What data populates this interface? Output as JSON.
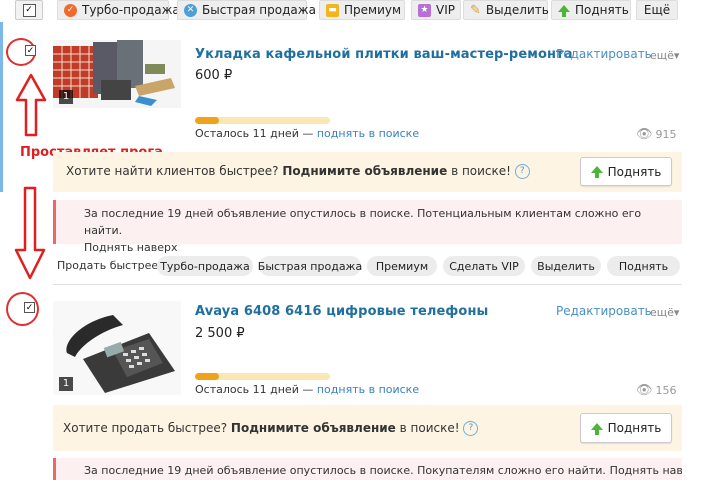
{
  "toolbar": {
    "turbo": "Турбо-продажа",
    "fast": "Быстрая продажа",
    "premium": "Премиум",
    "vip": "VIP",
    "highlight": "Выделить",
    "raise": "Поднять",
    "more": "Ещё"
  },
  "annotation": {
    "label": "Проставляет прога"
  },
  "listing1": {
    "checkbox": "✓",
    "title": "Укладка кафельной плитки ваш-мастер-ремонта",
    "price": "600 ₽",
    "edit": "Редактировать",
    "more": "ещё",
    "photo_count": "1",
    "days_left": "Осталось 11 дней —",
    "raise_link": "поднять в поиске",
    "views": "915",
    "progress": 0.18,
    "promo_q": "Хотите найти клиентов быстрее?",
    "promo_bold": "Поднимите объявление",
    "promo_tail": "в поиске!",
    "promo_help": "?",
    "raise_btn": "Поднять",
    "warn_text": "За последние 19 дней объявление опустилось в поиске. Потенциальным клиентам сложно его найти.",
    "warn_link": "Поднять наверх",
    "sell_faster": "Продать быстрее:",
    "pills": [
      "Турбо-продажа",
      "Быстрая продажа",
      "Премиум",
      "Сделать VIP",
      "Выделить",
      "Поднять"
    ]
  },
  "listing2": {
    "checkbox": "✓",
    "title": "Avaya 6408 6416 цифровые телефоны",
    "price": "2 500 ₽",
    "edit": "Редактировать",
    "more": "ещё",
    "photo_count": "1",
    "days_left": "Осталось 11 дней —",
    "raise_link": "поднять в поиске",
    "views": "156",
    "progress": 0.18,
    "promo_q": "Хотите продать быстрее?",
    "promo_bold": "Поднимите объявление",
    "promo_tail": "в поиске!",
    "promo_help": "?",
    "raise_btn": "Поднять",
    "warn_text": "За последние 19 дней объявление опустилось в поиске. Покупателям сложно его найти.",
    "warn_link": "Поднять наверх"
  },
  "colors": {
    "title": "#1f6f9f",
    "link": "#3a7fc0",
    "annotation_red": "#e02020",
    "progress_fill": "#f0a21a",
    "raise_green": "#4fb43a"
  }
}
